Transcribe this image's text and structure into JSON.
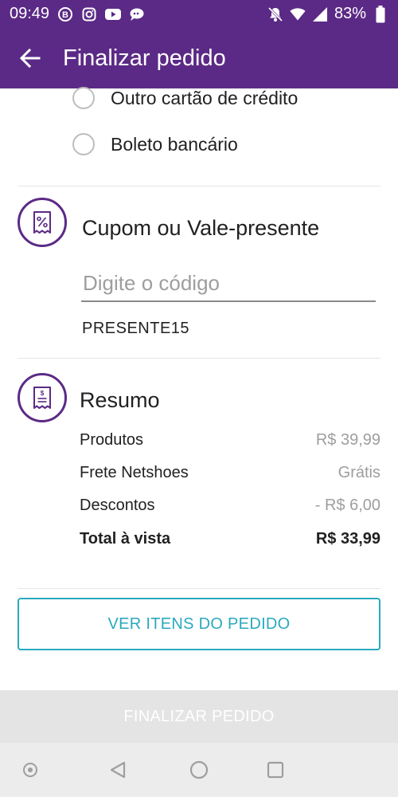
{
  "status_bar": {
    "time": "09:49",
    "battery": "83%",
    "left_icons": [
      "b-circle-icon",
      "instagram-icon",
      "youtube-icon",
      "chat-icon"
    ],
    "right_icons": [
      "mute-icon",
      "wifi-icon",
      "signal-icon",
      "battery-icon"
    ]
  },
  "app_bar": {
    "title": "Finalizar pedido",
    "back_icon": "arrow-back-icon",
    "background": "#5b2a86"
  },
  "payment_options": [
    {
      "label": "Outro cartão de crédito",
      "selected": false
    },
    {
      "label": "Boleto bancário",
      "selected": false
    }
  ],
  "coupon": {
    "title": "Cupom ou Vale-presente",
    "icon": "coupon-percent-icon",
    "placeholder": "Digite o código",
    "value": "",
    "applied_code": "PRESENTE15"
  },
  "summary": {
    "title": "Resumo",
    "icon": "receipt-icon",
    "rows": [
      {
        "label": "Produtos",
        "value": "R$ 39,99"
      },
      {
        "label": "Frete Netshoes",
        "value": "Grátis"
      },
      {
        "label": "Descontos",
        "value": "- R$ 6,00"
      }
    ],
    "total": {
      "label": "Total à vista",
      "value": "R$ 33,99"
    }
  },
  "buttons": {
    "view_items": "VER ITENS DO PEDIDO",
    "finalize": "FINALIZAR PEDIDO"
  },
  "nav_bar": {
    "icons": [
      "assistant-dot-icon",
      "back-triangle-icon",
      "home-circle-icon",
      "recents-square-icon"
    ]
  },
  "colors": {
    "primary": "#5b2a86",
    "accent": "#2aa9bd",
    "disabled": "#e4e4e4"
  }
}
